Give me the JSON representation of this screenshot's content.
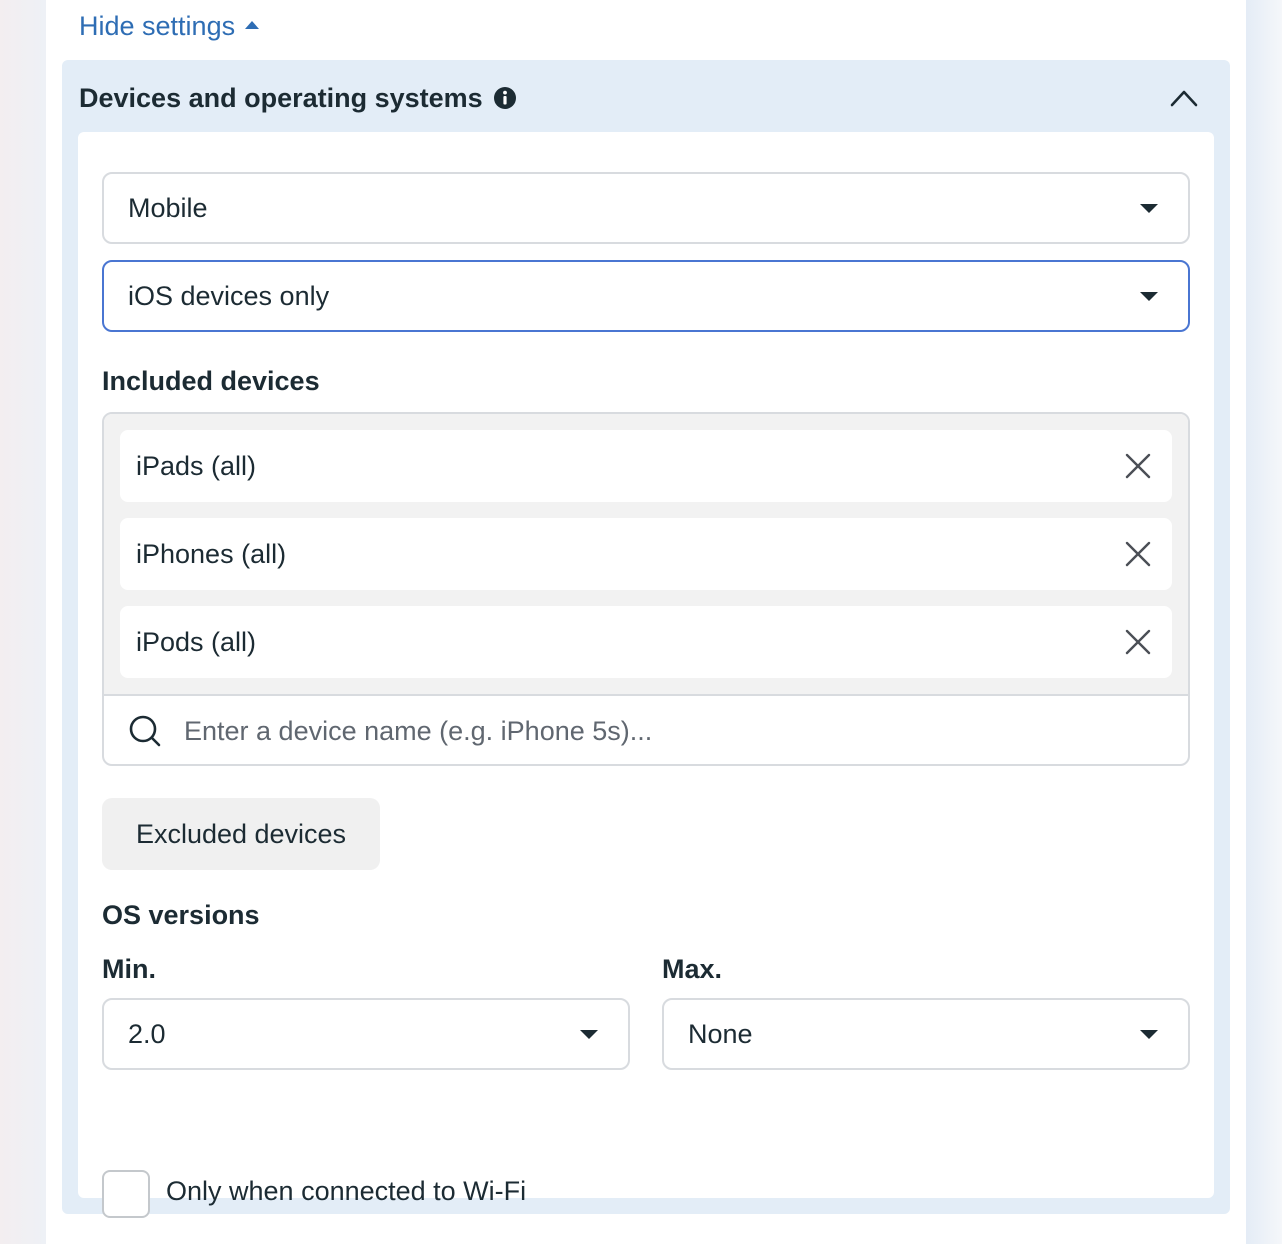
{
  "header": {
    "hide_settings_label": "Hide settings"
  },
  "section": {
    "title": "Devices and operating systems"
  },
  "device_type_select": {
    "value": "Mobile"
  },
  "platform_select": {
    "value": "iOS devices only"
  },
  "included_devices": {
    "label": "Included devices",
    "chips": [
      {
        "label": "iPads (all)"
      },
      {
        "label": "iPhones (all)"
      },
      {
        "label": "iPods (all)"
      }
    ],
    "search_placeholder": "Enter a device name (e.g. iPhone 5s)..."
  },
  "excluded_devices": {
    "label": "Excluded devices"
  },
  "os_versions": {
    "label": "OS versions",
    "min_label": "Min.",
    "min_value": "2.0",
    "max_label": "Max.",
    "max_value": "None"
  },
  "wifi": {
    "label": "Only when connected to Wi-Fi",
    "checked": false
  },
  "colors": {
    "link": "#2e6db4",
    "section_bg": "#e3edf7",
    "focus_border": "#4a76d2",
    "text": "#1c2b33"
  }
}
